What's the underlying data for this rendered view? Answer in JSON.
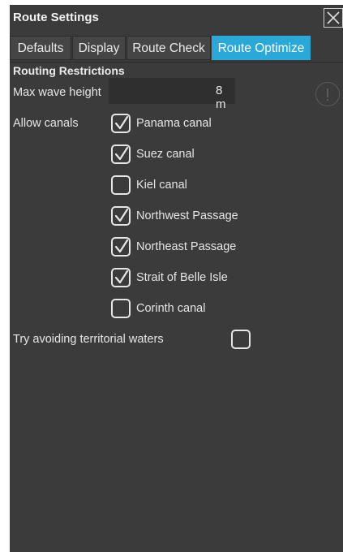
{
  "window": {
    "title": "Route Settings"
  },
  "tabs": [
    {
      "label": "Defaults",
      "active": false
    },
    {
      "label": "Display",
      "active": false
    },
    {
      "label": "Route Check",
      "active": false
    },
    {
      "label": "Route Optimize",
      "active": true
    }
  ],
  "routing_restrictions": {
    "heading": "Routing Restrictions",
    "max_wave_height": {
      "label": "Max wave height",
      "value": "8 m"
    },
    "allow_canals": {
      "label": "Allow canals",
      "canals": [
        {
          "name": "Panama canal",
          "checked": true
        },
        {
          "name": "Suez canal",
          "checked": true
        },
        {
          "name": "Kiel canal",
          "checked": false
        },
        {
          "name": "Northwest Passage",
          "checked": true
        },
        {
          "name": "Northeast Passage",
          "checked": true
        },
        {
          "name": "Strait of Belle Isle",
          "checked": true
        },
        {
          "name": "Corinth canal",
          "checked": false
        }
      ]
    },
    "territorial_waters": {
      "label": "Try avoiding territorial waters",
      "checked": false
    }
  },
  "colors": {
    "panel_bg": "#3b3b3b",
    "active_tab": "#2aa8d8",
    "text": "#e6e6e6"
  }
}
